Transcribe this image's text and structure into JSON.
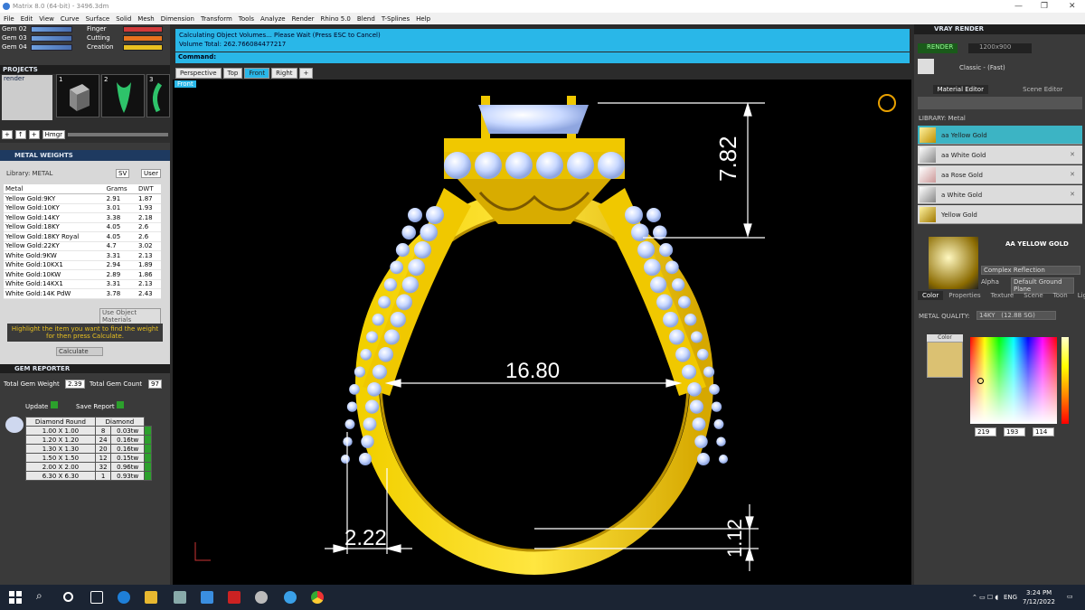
{
  "window": {
    "title": "Matrix 8.0 (64-bit) - 3496.3dm"
  },
  "menu": [
    "File",
    "Edit",
    "View",
    "Curve",
    "Surface",
    "Solid",
    "Mesh",
    "Dimension",
    "Transform",
    "Tools",
    "Analyze",
    "Render",
    "Rhino 5.0",
    "Blend",
    "T-Splines",
    "Help"
  ],
  "layers": [
    {
      "name": "Gem 02",
      "name2": "Finger",
      "color2": "#d23a3a"
    },
    {
      "name": "Gem 03",
      "name2": "Cutting",
      "color2": "#e8731e"
    },
    {
      "name": "Gem 04",
      "name2": "Creation",
      "color2": "#e8c020"
    }
  ],
  "projects": {
    "title": "PROJECTS",
    "item": "render",
    "nums": [
      "1",
      "2",
      "3"
    ],
    "btn": "Hmgr"
  },
  "metal_weights": {
    "title": "METAL WEIGHTS",
    "library": "Library: METAL",
    "sv": "SV",
    "user": "User",
    "columns": [
      "Metal",
      "Grams",
      "DWT"
    ],
    "rows": [
      [
        "Yellow Gold:9KY",
        "2.91",
        "1.87"
      ],
      [
        "Yellow Gold:10KY",
        "3.01",
        "1.93"
      ],
      [
        "Yellow Gold:14KY",
        "3.38",
        "2.18"
      ],
      [
        "Yellow Gold:18KY",
        "4.05",
        "2.6"
      ],
      [
        "Yellow Gold:18KY Royal",
        "4.05",
        "2.6"
      ],
      [
        "Yellow Gold:22KY",
        "4.7",
        "3.02"
      ],
      [
        "White Gold:9KW",
        "3.31",
        "2.13"
      ],
      [
        "White Gold:10KX1",
        "2.94",
        "1.89"
      ],
      [
        "White Gold:10KW",
        "2.89",
        "1.86"
      ],
      [
        "White Gold:14KX1",
        "3.31",
        "2.13"
      ],
      [
        "White Gold:14K PdW",
        "3.78",
        "2.43"
      ]
    ],
    "use_obj": "Use Object Materials",
    "hint": "Highlight the item you want to find the weight for then press Calculate.",
    "calculate": "Calculate"
  },
  "gem_reporter": {
    "title": "GEM REPORTER",
    "total_weight_label": "Total Gem Weight",
    "total_weight": "2.39",
    "total_count_label": "Total Gem Count",
    "total_count": "97",
    "update": "Update",
    "save": "Save Report",
    "col1": "Diamond Round",
    "col2": "Diamond",
    "rows": [
      [
        "1.00 X 1.00",
        "8",
        "0.03tw"
      ],
      [
        "1.20 X 1.20",
        "24",
        "0.16tw"
      ],
      [
        "1.30 X 1.30",
        "20",
        "0.16tw"
      ],
      [
        "1.50 X 1.50",
        "12",
        "0.15tw"
      ],
      [
        "2.00 X 2.00",
        "32",
        "0.96tw"
      ],
      [
        "6.30 X 6.30",
        "1",
        "0.93tw"
      ]
    ]
  },
  "status": {
    "line1": "Calculating Object Volumes... Please Wait (Press ESC to Cancel)",
    "line2": "Volume Total: 262.766084477217",
    "command": "Command:"
  },
  "viewtabs": [
    "Perspective",
    "Top",
    "Front",
    "Right"
  ],
  "viewport": {
    "label": "Front",
    "dims": {
      "top": "7.82",
      "width": "16.80",
      "band": "2.22",
      "bottom": "1.12"
    }
  },
  "vray": {
    "title": "VRAY RENDER",
    "render": "RENDER",
    "size": "1200x900",
    "preset": "Classic - (Fast)",
    "tabs": [
      "Material Editor",
      "Scene Editor"
    ],
    "library": "LIBRARY: Metal",
    "materials": [
      "aa Yellow Gold",
      "aa White Gold",
      "aa Rose Gold",
      "a White Gold",
      "Yellow Gold"
    ],
    "preview_name": "AA YELLOW GOLD",
    "reflection": "Complex Reflection",
    "alpha": "Alpha",
    "ground": "Default Ground Plane",
    "subtabs": [
      "Color",
      "Properties",
      "Texture",
      "Scene",
      "Toon",
      "Light"
    ],
    "quality_label": "METAL QUALITY:",
    "quality": "14KY",
    "quality_weight": "(12.88 SG)",
    "color_label": "Color",
    "rgb": [
      "219",
      "193",
      "114"
    ],
    "swatch": "#dbc172"
  },
  "taskbar": {
    "time": "3:24 PM",
    "date": "7/12/2022",
    "lang": "ENG"
  }
}
